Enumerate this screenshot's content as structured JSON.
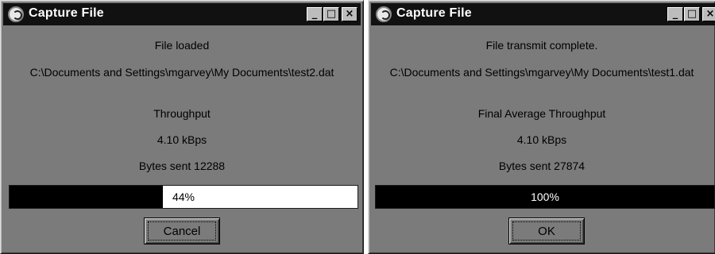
{
  "windows": [
    {
      "title": "Capture File",
      "status": "File loaded",
      "path": "C:\\Documents and Settings\\mgarvey\\My Documents\\test2.dat",
      "throughput_label": "Throughput",
      "throughput_value": "4.10 kBps",
      "bytes_sent": "Bytes sent 12288",
      "progress_text": "44%",
      "progress_fraction": 0.44,
      "button_label": "Cancel"
    },
    {
      "title": "Capture File",
      "status": "File transmit complete.",
      "path": "C:\\Documents and Settings\\mgarvey\\My Documents\\test1.dat",
      "throughput_label": "Final Average Throughput",
      "throughput_value": "4.10 kBps",
      "bytes_sent": "Bytes sent 27874",
      "progress_text": "100%",
      "progress_fraction": 1.0,
      "button_label": "OK"
    }
  ],
  "titlebar_buttons": {
    "minimize": "_",
    "maximize": "□",
    "close": "×"
  },
  "colors": {
    "window_bg": "#7b7b7b",
    "titlebar_bg": "#111111",
    "progress_bar": "#000000",
    "progress_remaining": "#ffffff"
  }
}
